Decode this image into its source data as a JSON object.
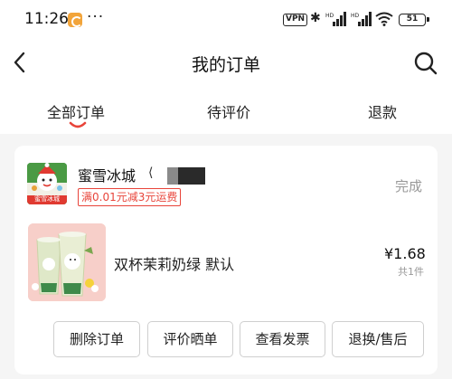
{
  "status_bar": {
    "time": "11:26",
    "more": "···",
    "vpn": "VPN",
    "battery": "51",
    "icons": [
      "app-badge-icon",
      "bluetooth-icon",
      "signal-icon",
      "signal-icon",
      "wifi-icon",
      "battery-icon"
    ]
  },
  "header": {
    "title": "我的订单",
    "back_icon": "chevron-left-icon",
    "search_icon": "search-icon"
  },
  "tabs": [
    {
      "label": "全部订单",
      "active": true
    },
    {
      "label": "待评价",
      "active": false
    },
    {
      "label": "退款",
      "active": false
    }
  ],
  "colors": {
    "accent_red": "#e8443a",
    "background": "#f5f5f5",
    "muted_text": "#999999"
  },
  "order": {
    "store_logo_text": "蜜雪冰城",
    "store_name": "蜜雪冰城",
    "promo": "满0.01元减3元运费",
    "status": "完成",
    "product_name": "双杯茉莉奶绿 默认",
    "price": "¥1.68",
    "quantity": "共1件",
    "actions": [
      "删除订单",
      "评价晒单",
      "查看发票",
      "退换/售后"
    ]
  }
}
